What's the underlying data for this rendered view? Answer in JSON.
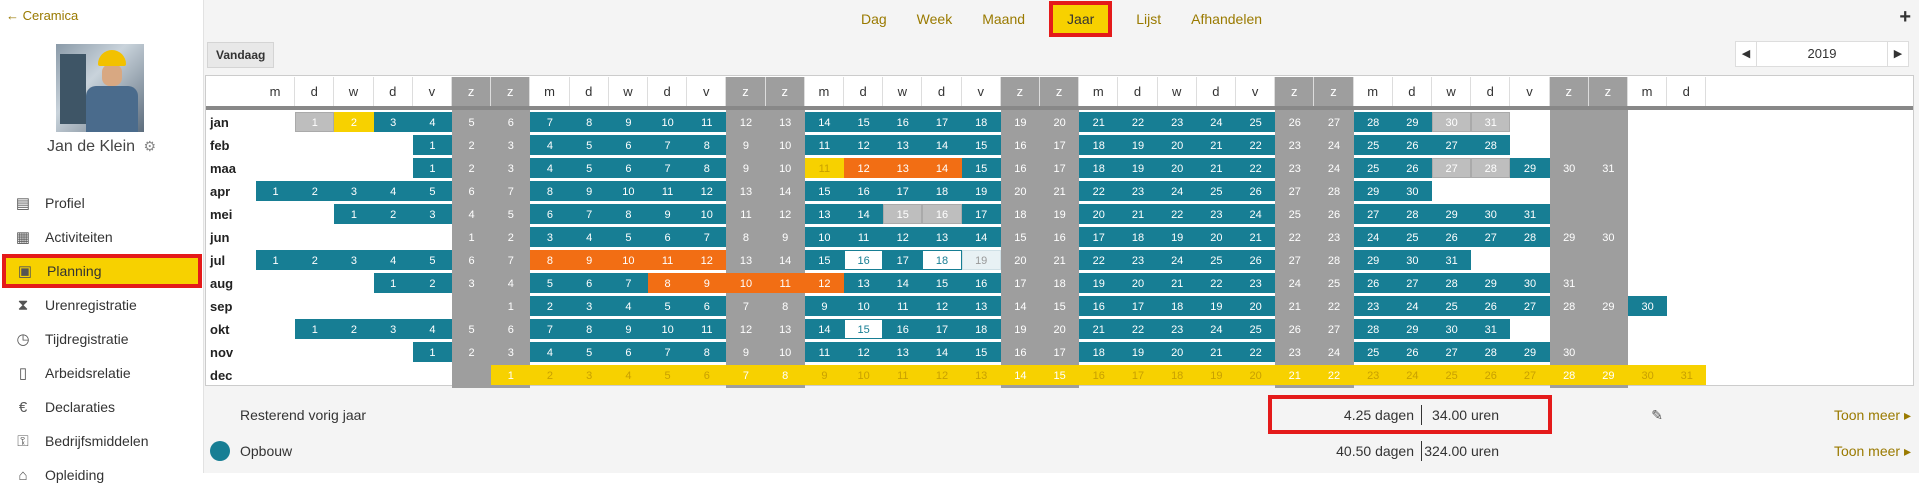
{
  "sidebar": {
    "back_label": "Ceramica",
    "user_name": "Jan de Klein",
    "items": [
      {
        "label": "Profiel",
        "icon": "profile-card-icon",
        "glyph": "▤"
      },
      {
        "label": "Activiteiten",
        "icon": "table-icon",
        "glyph": "▦"
      },
      {
        "label": "Planning",
        "icon": "calendar-icon",
        "glyph": "▣",
        "active": true
      },
      {
        "label": "Urenregistratie",
        "icon": "hourglass-icon",
        "glyph": "⧗"
      },
      {
        "label": "Tijdregistratie",
        "icon": "stopwatch-icon",
        "glyph": "◷"
      },
      {
        "label": "Arbeidsrelatie",
        "icon": "document-icon",
        "glyph": "▯"
      },
      {
        "label": "Declaraties",
        "icon": "euro-icon",
        "glyph": "€"
      },
      {
        "label": "Bedrijfsmiddelen",
        "icon": "key-icon",
        "glyph": "⚿"
      },
      {
        "label": "Opleiding",
        "icon": "graduation-icon",
        "glyph": "⌂"
      }
    ]
  },
  "topnav": {
    "tabs": [
      {
        "label": "Dag"
      },
      {
        "label": "Week"
      },
      {
        "label": "Maand"
      },
      {
        "label": "Jaar",
        "active": true
      },
      {
        "label": "Lijst"
      },
      {
        "label": "Afhandelen"
      }
    ],
    "plus": "+"
  },
  "toolbar": {
    "today_label": "Vandaag",
    "year": "2019",
    "prev": "◀",
    "next": "▶"
  },
  "calendar": {
    "day_headers": [
      "m",
      "d",
      "w",
      "d",
      "v",
      "z",
      "z",
      "m",
      "d",
      "w",
      "d",
      "v",
      "z",
      "z",
      "m",
      "d",
      "w",
      "d",
      "v",
      "z",
      "z",
      "m",
      "d",
      "w",
      "d",
      "v",
      "z",
      "z",
      "m",
      "d",
      "w",
      "d",
      "v",
      "z",
      "z",
      "m",
      "d"
    ],
    "months": [
      {
        "label": "jan",
        "offset": 1,
        "days": 31
      },
      {
        "label": "feb",
        "offset": 4,
        "days": 28
      },
      {
        "label": "maa",
        "offset": 4,
        "days": 31
      },
      {
        "label": "apr",
        "offset": 0,
        "days": 30
      },
      {
        "label": "mei",
        "offset": 2,
        "days": 31
      },
      {
        "label": "jun",
        "offset": 5,
        "days": 30
      },
      {
        "label": "jul",
        "offset": 0,
        "days": 31
      },
      {
        "label": "aug",
        "offset": 3,
        "days": 31
      },
      {
        "label": "sep",
        "offset": 6,
        "days": 30
      },
      {
        "label": "okt",
        "offset": 1,
        "days": 31
      },
      {
        "label": "nov",
        "offset": 4,
        "days": 30
      },
      {
        "label": "dec",
        "offset": 6,
        "days": 31
      }
    ],
    "special_days": {
      "jan": {
        "1": "lg",
        "2": "y",
        "30": "lg",
        "31": "lg"
      },
      "maa": {
        "11": "y2",
        "12": "o",
        "13": "o",
        "14": "o",
        "27": "lg",
        "28": "lg"
      },
      "mei": {
        "15": "lg",
        "16": "lg"
      },
      "jul": {
        "8": "o",
        "9": "o",
        "10": "o",
        "11": "o",
        "12": "o",
        "16": "w",
        "18": "w",
        "19": "lb"
      },
      "aug": {
        "8": "o",
        "9": "o",
        "10": "o",
        "11": "o",
        "12": "o"
      },
      "okt": {
        "15": "w"
      },
      "dec": {
        "all": "y"
      }
    }
  },
  "summary": [
    {
      "label": "Resterend vorig jaar",
      "days": "4.25 dagen",
      "hours": "34.00 uren",
      "more": "Toon meer ▸",
      "editable": true
    },
    {
      "label": "Opbouw",
      "days": "40.50 dagen",
      "hours": "324.00 uren",
      "more": "Toon meer ▸",
      "dot_color": "#177e94"
    }
  ],
  "colors": {
    "accent": "#f7d100",
    "teal": "#177e94",
    "orange": "#f26e14",
    "weekend": "#9e9e9e",
    "highlight": "#e41a1a"
  }
}
